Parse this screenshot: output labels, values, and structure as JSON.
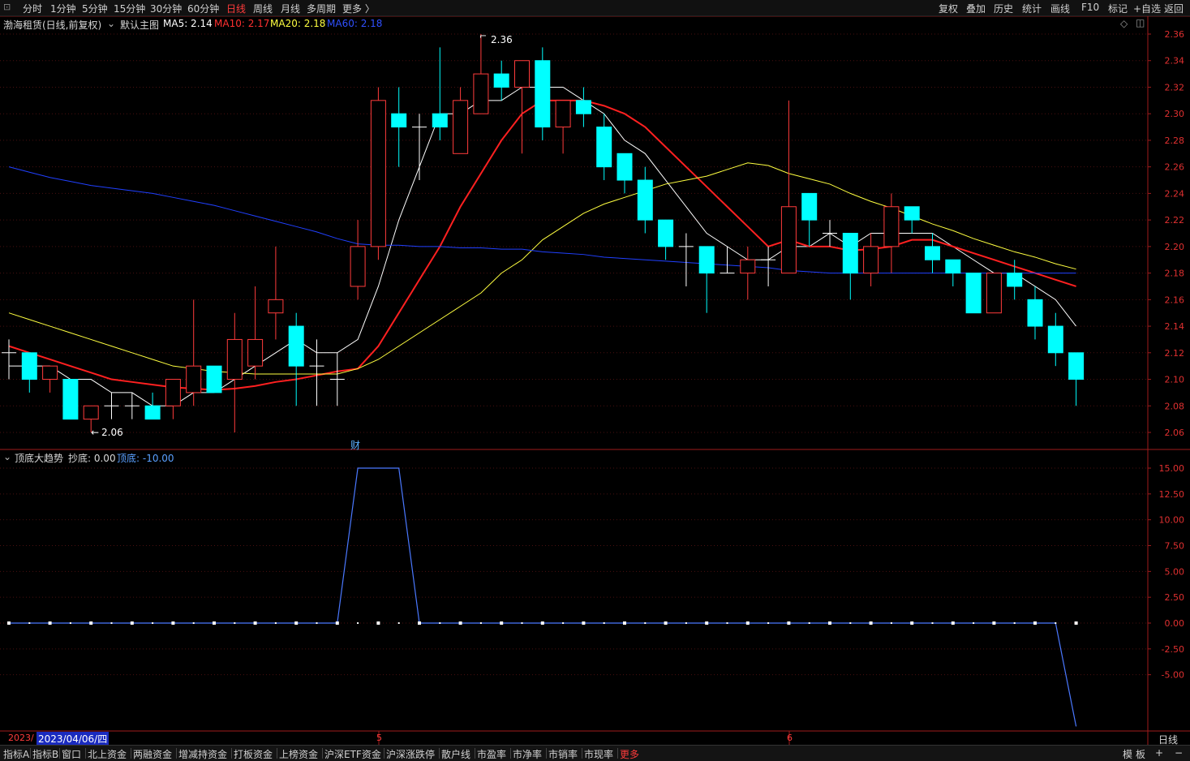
{
  "toolbar": {
    "left_items": [
      {
        "label": "分时",
        "active": false
      },
      {
        "label": "1分钟",
        "active": false
      },
      {
        "label": "5分钟",
        "active": false
      },
      {
        "label": "15分钟",
        "active": false
      },
      {
        "label": "30分钟",
        "active": false
      },
      {
        "label": "60分钟",
        "active": false
      },
      {
        "label": "日线",
        "active": true
      },
      {
        "label": "周线",
        "active": false
      },
      {
        "label": "月线",
        "active": false
      },
      {
        "label": "多周期",
        "active": false
      },
      {
        "label": "更多 〉",
        "active": false
      }
    ],
    "right_items": [
      "复权",
      "叠加",
      "历史",
      "统计",
      "画线",
      "F10",
      "标记",
      "+自选",
      "返回"
    ]
  },
  "main_chart": {
    "title": "渤海租赁(日线,前复权)",
    "template_label": "默认主图",
    "ma5_label": "MA5: 2.14",
    "ma10_label": "MA10: 2.17",
    "ma20_label": "MA20: 2.18",
    "ma60_label": "MA60: 2.18",
    "high_annotation": "2.36",
    "low_annotation": "2.06",
    "finance_marker": "财",
    "colors": {
      "up": "#ff3b3b",
      "down": "#00ffff",
      "ma5": "#ffffff",
      "ma10": "#ff2020",
      "ma20": "#ffff40",
      "ma60": "#2040ff",
      "background": "#000000",
      "grid": "#7a1818"
    }
  },
  "indicator_panel": {
    "title": "顶底大趋势",
    "label_chaodi": "抄底: 0.00",
    "label_dingdi": "顶底: -10.00"
  },
  "date_axis": {
    "year_clip": "2023/",
    "cursor_date": "2023/04/06/四",
    "month_5": "5",
    "month_6": "6",
    "period_label": "日线"
  },
  "bottom_tabs": [
    {
      "label": "指标A",
      "active": false
    },
    {
      "label": "指标B",
      "active": false
    },
    {
      "label": "窗口",
      "active": false
    },
    {
      "label": "北上资金",
      "active": false
    },
    {
      "label": "两融资金",
      "active": false
    },
    {
      "label": "增减持资金",
      "active": false
    },
    {
      "label": "打板资金",
      "active": false
    },
    {
      "label": "上榜资金",
      "active": false
    },
    {
      "label": "沪深ETF资金",
      "active": false
    },
    {
      "label": "沪深涨跌停",
      "active": false
    },
    {
      "label": "散户线",
      "active": false
    },
    {
      "label": "市盈率",
      "active": false
    },
    {
      "label": "市净率",
      "active": false
    },
    {
      "label": "市销率",
      "active": false
    },
    {
      "label": "市现率",
      "active": false
    },
    {
      "label": "更多",
      "active": true
    }
  ],
  "bottom_right": [
    "模",
    "板",
    "+",
    "−"
  ],
  "chart_data": [
    {
      "type": "candlestick",
      "title": "渤海租赁(日线,前复权)",
      "ylim": [
        2.05,
        2.37
      ],
      "y_ticks": [
        "2.36",
        "2.34",
        "2.32",
        "2.30",
        "2.28",
        "2.26",
        "2.24",
        "2.22",
        "2.20",
        "2.18",
        "2.16",
        "2.14",
        "2.12",
        "2.10",
        "2.08",
        "2.06"
      ],
      "candles": [
        {
          "o": 2.12,
          "h": 2.13,
          "l": 2.1,
          "c": 2.12
        },
        {
          "o": 2.12,
          "h": 2.12,
          "l": 2.09,
          "c": 2.1
        },
        {
          "o": 2.1,
          "h": 2.11,
          "l": 2.09,
          "c": 2.11
        },
        {
          "o": 2.1,
          "h": 2.1,
          "l": 2.07,
          "c": 2.07
        },
        {
          "o": 2.07,
          "h": 2.08,
          "l": 2.06,
          "c": 2.08
        },
        {
          "o": 2.08,
          "h": 2.09,
          "l": 2.07,
          "c": 2.08
        },
        {
          "o": 2.08,
          "h": 2.09,
          "l": 2.07,
          "c": 2.08
        },
        {
          "o": 2.08,
          "h": 2.09,
          "l": 2.07,
          "c": 2.07
        },
        {
          "o": 2.08,
          "h": 2.1,
          "l": 2.07,
          "c": 2.1
        },
        {
          "o": 2.09,
          "h": 2.16,
          "l": 2.08,
          "c": 2.11
        },
        {
          "o": 2.11,
          "h": 2.11,
          "l": 2.09,
          "c": 2.09
        },
        {
          "o": 2.1,
          "h": 2.15,
          "l": 2.06,
          "c": 2.13
        },
        {
          "o": 2.11,
          "h": 2.17,
          "l": 2.1,
          "c": 2.13
        },
        {
          "o": 2.15,
          "h": 2.2,
          "l": 2.13,
          "c": 2.16
        },
        {
          "o": 2.14,
          "h": 2.15,
          "l": 2.08,
          "c": 2.11
        },
        {
          "o": 2.11,
          "h": 2.13,
          "l": 2.08,
          "c": 2.11
        },
        {
          "o": 2.1,
          "h": 2.12,
          "l": 2.08,
          "c": 2.1
        },
        {
          "o": 2.17,
          "h": 2.22,
          "l": 2.16,
          "c": 2.2
        },
        {
          "o": 2.2,
          "h": 2.32,
          "l": 2.19,
          "c": 2.31
        },
        {
          "o": 2.3,
          "h": 2.32,
          "l": 2.26,
          "c": 2.29
        },
        {
          "o": 2.29,
          "h": 2.3,
          "l": 2.25,
          "c": 2.29
        },
        {
          "o": 2.3,
          "h": 2.35,
          "l": 2.28,
          "c": 2.29
        },
        {
          "o": 2.27,
          "h": 2.32,
          "l": 2.27,
          "c": 2.31
        },
        {
          "o": 2.3,
          "h": 2.36,
          "l": 2.3,
          "c": 2.33
        },
        {
          "o": 2.33,
          "h": 2.34,
          "l": 2.31,
          "c": 2.32
        },
        {
          "o": 2.32,
          "h": 2.34,
          "l": 2.27,
          "c": 2.34
        },
        {
          "o": 2.34,
          "h": 2.35,
          "l": 2.28,
          "c": 2.29
        },
        {
          "o": 2.29,
          "h": 2.31,
          "l": 2.27,
          "c": 2.31
        },
        {
          "o": 2.31,
          "h": 2.32,
          "l": 2.29,
          "c": 2.3
        },
        {
          "o": 2.29,
          "h": 2.3,
          "l": 2.25,
          "c": 2.26
        },
        {
          "o": 2.27,
          "h": 2.27,
          "l": 2.24,
          "c": 2.25
        },
        {
          "o": 2.25,
          "h": 2.26,
          "l": 2.21,
          "c": 2.22
        },
        {
          "o": 2.22,
          "h": 2.22,
          "l": 2.19,
          "c": 2.2
        },
        {
          "o": 2.2,
          "h": 2.21,
          "l": 2.17,
          "c": 2.2
        },
        {
          "o": 2.2,
          "h": 2.2,
          "l": 2.15,
          "c": 2.18
        },
        {
          "o": 2.18,
          "h": 2.2,
          "l": 2.18,
          "c": 2.18
        },
        {
          "o": 2.18,
          "h": 2.2,
          "l": 2.16,
          "c": 2.19
        },
        {
          "o": 2.19,
          "h": 2.2,
          "l": 2.17,
          "c": 2.19
        },
        {
          "o": 2.18,
          "h": 2.31,
          "l": 2.18,
          "c": 2.23
        },
        {
          "o": 2.24,
          "h": 2.24,
          "l": 2.2,
          "c": 2.22
        },
        {
          "o": 2.21,
          "h": 2.22,
          "l": 2.2,
          "c": 2.21
        },
        {
          "o": 2.21,
          "h": 2.21,
          "l": 2.16,
          "c": 2.18
        },
        {
          "o": 2.18,
          "h": 2.21,
          "l": 2.17,
          "c": 2.2
        },
        {
          "o": 2.2,
          "h": 2.24,
          "l": 2.18,
          "c": 2.23
        },
        {
          "o": 2.23,
          "h": 2.23,
          "l": 2.21,
          "c": 2.22
        },
        {
          "o": 2.2,
          "h": 2.21,
          "l": 2.18,
          "c": 2.19
        },
        {
          "o": 2.19,
          "h": 2.19,
          "l": 2.17,
          "c": 2.18
        },
        {
          "o": 2.18,
          "h": 2.18,
          "l": 2.15,
          "c": 2.15
        },
        {
          "o": 2.15,
          "h": 2.18,
          "l": 2.15,
          "c": 2.18
        },
        {
          "o": 2.18,
          "h": 2.19,
          "l": 2.16,
          "c": 2.17
        },
        {
          "o": 2.16,
          "h": 2.17,
          "l": 2.13,
          "c": 2.14
        },
        {
          "o": 2.14,
          "h": 2.15,
          "l": 2.11,
          "c": 2.12
        },
        {
          "o": 2.12,
          "h": 2.12,
          "l": 2.08,
          "c": 2.1
        }
      ],
      "series": [
        {
          "name": "MA5",
          "values": [
            2.11,
            2.11,
            2.11,
            2.1,
            2.1,
            2.09,
            2.09,
            2.08,
            2.08,
            2.09,
            2.09,
            2.1,
            2.11,
            2.12,
            2.13,
            2.12,
            2.12,
            2.13,
            2.17,
            2.22,
            2.26,
            2.3,
            2.3,
            2.31,
            2.31,
            2.32,
            2.32,
            2.32,
            2.31,
            2.3,
            2.28,
            2.27,
            2.25,
            2.23,
            2.21,
            2.2,
            2.19,
            2.19,
            2.2,
            2.2,
            2.21,
            2.2,
            2.21,
            2.21,
            2.21,
            2.21,
            2.2,
            2.19,
            2.18,
            2.18,
            2.17,
            2.16,
            2.14
          ]
        },
        {
          "name": "MA10",
          "values": [
            2.125,
            2.12,
            2.115,
            2.11,
            2.105,
            2.1,
            2.098,
            2.096,
            2.094,
            2.093,
            2.092,
            2.093,
            2.095,
            2.098,
            2.1,
            2.103,
            2.106,
            2.108,
            2.125,
            2.15,
            2.175,
            2.2,
            2.23,
            2.255,
            2.28,
            2.3,
            2.31,
            2.31,
            2.31,
            2.306,
            2.3,
            2.29,
            2.275,
            2.26,
            2.245,
            2.23,
            2.215,
            2.2,
            2.205,
            2.2,
            2.2,
            2.197,
            2.198,
            2.2,
            2.205,
            2.205,
            2.2,
            2.195,
            2.19,
            2.185,
            2.18,
            2.175,
            2.17
          ]
        },
        {
          "name": "MA20",
          "values": [
            2.15,
            2.145,
            2.14,
            2.135,
            2.13,
            2.125,
            2.12,
            2.115,
            2.11,
            2.108,
            2.106,
            2.105,
            2.104,
            2.104,
            2.104,
            2.104,
            2.104,
            2.108,
            2.115,
            2.125,
            2.135,
            2.145,
            2.155,
            2.165,
            2.18,
            2.19,
            2.205,
            2.215,
            2.225,
            2.232,
            2.237,
            2.242,
            2.247,
            2.25,
            2.253,
            2.258,
            2.263,
            2.261,
            2.255,
            2.251,
            2.247,
            2.24,
            2.234,
            2.229,
            2.223,
            2.217,
            2.212,
            2.206,
            2.201,
            2.196,
            2.192,
            2.187,
            2.183
          ]
        },
        {
          "name": "MA60",
          "values": [
            2.26,
            2.256,
            2.252,
            2.249,
            2.246,
            2.244,
            2.242,
            2.24,
            2.237,
            2.234,
            2.231,
            2.227,
            2.223,
            2.219,
            2.215,
            2.211,
            2.206,
            2.202,
            2.201,
            2.201,
            2.2,
            2.2,
            2.199,
            2.199,
            2.198,
            2.198,
            2.196,
            2.195,
            2.194,
            2.192,
            2.191,
            2.19,
            2.189,
            2.188,
            2.187,
            2.186,
            2.185,
            2.184,
            2.182,
            2.181,
            2.18,
            2.18,
            2.18,
            2.18,
            2.18,
            2.18,
            2.18,
            2.18,
            2.18,
            2.18,
            2.18,
            2.18,
            2.18
          ]
        }
      ]
    },
    {
      "type": "line",
      "title": "顶底大趋势",
      "ylim": [
        -8,
        16.5
      ],
      "y_ticks": [
        "15.00",
        "12.50",
        "10.00",
        "7.50",
        "5.00",
        "2.50",
        "0.00",
        "-2.50",
        "-5.00"
      ],
      "series": [
        {
          "name": "顶底",
          "values": [
            0,
            0,
            0,
            0,
            0,
            0,
            0,
            0,
            0,
            0,
            0,
            0,
            0,
            0,
            0,
            0,
            0,
            15,
            15,
            15,
            0,
            0,
            0,
            0,
            0,
            0,
            0,
            0,
            0,
            0,
            0,
            0,
            0,
            0,
            0,
            0,
            0,
            0,
            0,
            0,
            0,
            0,
            0,
            0,
            0,
            0,
            0,
            0,
            0,
            0,
            0,
            0,
            -10
          ]
        },
        {
          "name": "抄底",
          "values": [
            0,
            0,
            0,
            0,
            0,
            0,
            0,
            0,
            0,
            0,
            0,
            0,
            0,
            0,
            0,
            0,
            0,
            0,
            0,
            0,
            0,
            0,
            0,
            0,
            0,
            0,
            0,
            0,
            0,
            0,
            0,
            0,
            0,
            0,
            0,
            0,
            0,
            0,
            0,
            0,
            0,
            0,
            0,
            0,
            0,
            0,
            0,
            0,
            0,
            0,
            0,
            0,
            0
          ]
        }
      ]
    }
  ]
}
